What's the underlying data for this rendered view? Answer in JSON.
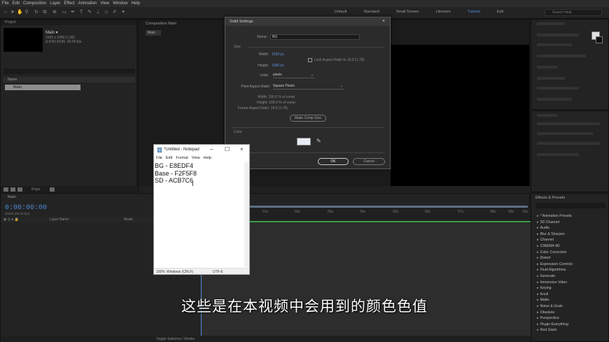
{
  "menubar": [
    "File",
    "Edit",
    "Composition",
    "Layer",
    "Effect",
    "Animation",
    "View",
    "Window",
    "Help"
  ],
  "workspaces": [
    {
      "label": "Default",
      "active": false
    },
    {
      "label": "Standard",
      "active": false
    },
    {
      "label": "Small Screen",
      "active": false
    },
    {
      "label": "Libraries",
      "active": false
    },
    {
      "label": "Tutorial",
      "active": true
    },
    {
      "label": "Edit",
      "active": false
    }
  ],
  "search_help_placeholder": "Search Help",
  "project": {
    "item_name": "Main ▾",
    "meta_line1": "1920 x 1080 (1.00)",
    "meta_line2": "Δ 0;00;10;00, 60.00 fps",
    "column_name": "Name",
    "row_label": "Main",
    "bpc": "8 bpc"
  },
  "composition": {
    "tab_label": "Composition Main",
    "breadcrumb": "Main"
  },
  "solid_settings": {
    "title": "Solid Settings",
    "name_label": "Name:",
    "name_value": "BG",
    "size_label": "Size",
    "width_label": "Width:",
    "width_value": "1920 px",
    "height_label": "Height:",
    "height_value": "1080 px",
    "lock_label": "Lock Aspect Ratio to 16:9 (1.78)",
    "units_label": "Units:",
    "units_value": "pixels",
    "par_label": "Pixel Aspect Ratio:",
    "par_value": "Square Pixels",
    "info_width": "Width: 100.0 % of comp",
    "info_height": "Height: 100.0 % of comp",
    "info_frame_ratio": "Frame Aspect Ratio: 16:9 (1.78)",
    "make_comp_size": "Make Comp Size",
    "color_label": "Color",
    "color_value": "#E8EDF4",
    "ok_label": "OK",
    "cancel_label": "Cancel"
  },
  "notepad": {
    "title": "*Untitled - Notepad",
    "menu": [
      "File",
      "Edit",
      "Format",
      "View",
      "Help"
    ],
    "lines": [
      "BG - E8EDF4",
      "Base - F2F5F8",
      "SD - ACB7C6"
    ],
    "zoom": "100%",
    "line_ending": "Windows (CRLF)",
    "encoding": "UTF-8"
  },
  "timeline": {
    "tab_label": "Main",
    "timecode": "0:00:00:00",
    "timecode_sub": "00000 (60.00 fps)",
    "col_source": "Layer Name",
    "col_mode": "Mode",
    "ruler_labels": [
      "0s",
      "01s",
      "02s",
      "03s",
      "04s",
      "05s",
      "06s",
      "07s",
      "08s",
      "09s",
      "10s"
    ],
    "toggle_label": "Toggle Switches / Modes"
  },
  "effects": {
    "title": "Effects & Presets",
    "items": [
      "* Animation Presets",
      "3D Channel",
      "Audio",
      "Blur & Sharpen",
      "Channel",
      "CINEMA 4D",
      "Color Correction",
      "Distort",
      "Expression Controls",
      "Fluid Algorithms",
      "Generate",
      "Immersive Video",
      "Keying",
      "Knoll",
      "Matte",
      "Noise & Grain",
      "Obsolete",
      "Perspective",
      "Plugin Everything",
      "Red Giant"
    ]
  },
  "subtitle": "这些是在本视频中会用到的颜色色值",
  "colors": {
    "accent_blue": "#4a8ad8",
    "solid_swatch": "#e8edf4",
    "timeline_green": "#3fa048"
  }
}
